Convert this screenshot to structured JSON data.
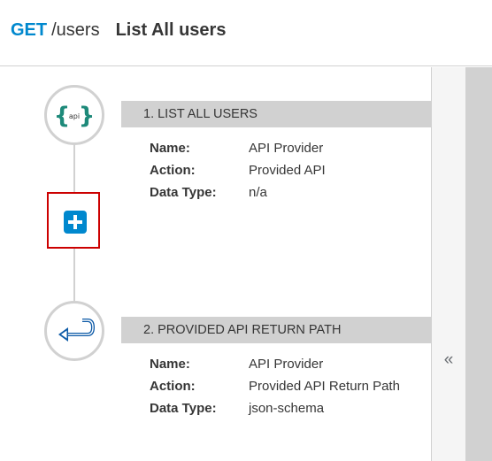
{
  "header": {
    "method": "GET",
    "path": "/users",
    "title": "List All users"
  },
  "steps": [
    {
      "title": "1. LIST ALL USERS",
      "icon": "api-braces-icon",
      "properties": [
        {
          "label": "Name:",
          "value": "API Provider"
        },
        {
          "label": "Action:",
          "value": "Provided API"
        },
        {
          "label": "Data Type:",
          "value": "n/a"
        }
      ]
    },
    {
      "title": "2. PROVIDED API RETURN PATH",
      "icon": "return-arrow-icon",
      "properties": [
        {
          "label": "Name:",
          "value": "API Provider"
        },
        {
          "label": "Action:",
          "value": "Provided API Return Path"
        },
        {
          "label": "Data Type:",
          "value": "json-schema"
        }
      ]
    }
  ],
  "node_icon_text": "api",
  "add_step_icon": "plus-icon",
  "collapse_icon": "double-chevron-left-icon",
  "collapse_glyph": "«",
  "colors": {
    "accent": "#0088ce",
    "api_braces": "#1e8a7a",
    "highlight_border": "#cc0000",
    "step_bar": "#d1d1d1"
  }
}
